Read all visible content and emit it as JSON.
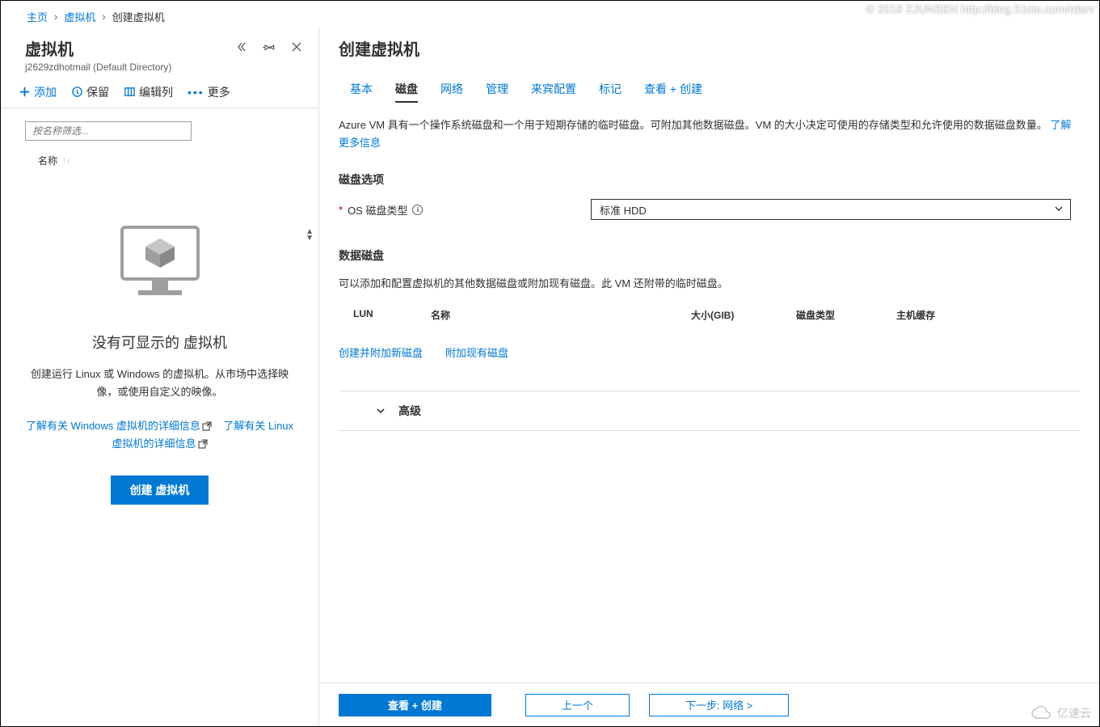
{
  "breadcrumb": {
    "home": "主页",
    "vms": "虚拟机",
    "current": "创建虚拟机"
  },
  "left": {
    "title": "虚拟机",
    "subtitle": "j2629zdhotmail (Default Directory)",
    "toolbar": {
      "add": "添加",
      "keep": "保留",
      "editCols": "编辑列",
      "more": "更多"
    },
    "filter_placeholder": "按名称筛选...",
    "col_name": "名称",
    "empty": {
      "title": "没有可显示的 虚拟机",
      "desc": "创建运行 Linux 或 Windows 的虚拟机。从市场中选择映像，或使用自定义的映像。",
      "link_win": "了解有关 Windows 虚拟机的详细信息",
      "link_linux": "了解有关 Linux 虚拟机的详细信息",
      "create_btn": "创建 虚拟机"
    }
  },
  "right": {
    "title": "创建虚拟机",
    "tabs": [
      "基本",
      "磁盘",
      "网络",
      "管理",
      "来宾配置",
      "标记",
      "查看 + 创建"
    ],
    "active_tab": 1,
    "intro_a": "Azure VM 具有一个操作系统磁盘和一个用于短期存储的临时磁盘。可附加其他数据磁盘。VM 的大小决定可使用的存储类型和允许使用的数据磁盘数量。 ",
    "intro_link": "了解更多信息",
    "disk_options_title": "磁盘选项",
    "os_disk_label": "OS 磁盘类型",
    "os_disk_value": "标准 HDD",
    "data_disks_title": "数据磁盘",
    "data_disks_desc": "可以添加和配置虚拟机的其他数据磁盘或附加现有磁盘。此 VM 还附带的临时磁盘。",
    "table": {
      "lun": "LUN",
      "name": "名称",
      "size": "大小(GIB)",
      "type": "磁盘类型",
      "cache": "主机缓存"
    },
    "link_create_attach": "创建并附加新磁盘",
    "link_attach_existing": "附加现有磁盘",
    "advanced": "高级",
    "footer": {
      "review": "查看 + 创建",
      "prev": "上一个",
      "next": "下一步: 网络 >"
    }
  },
  "watermark_top": "© 2018 ZJUNSEN http://blog.51cto.com/rdsrv",
  "watermark_bot": "亿速云"
}
